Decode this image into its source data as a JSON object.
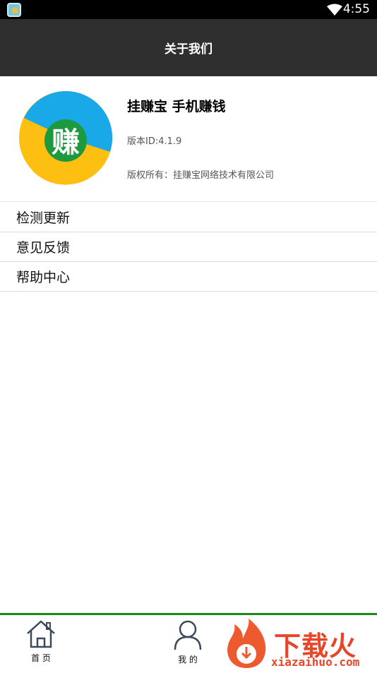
{
  "status_bar": {
    "time": "4:55"
  },
  "header": {
    "title": "关于我们"
  },
  "app": {
    "logo_char": "赚",
    "name": "挂赚宝 手机赚钱",
    "version": "版本ID:4.1.9",
    "copyright": "版权所有：挂赚宝网络技术有限公司"
  },
  "menu": [
    {
      "label": "检测更新"
    },
    {
      "label": "意见反馈"
    },
    {
      "label": "帮助中心"
    }
  ],
  "bottom_nav": [
    {
      "label": "首 页"
    },
    {
      "label": "我 的"
    }
  ],
  "watermark": {
    "text": "下载火",
    "url": "xiazaihuo.com"
  },
  "colors": {
    "title_bar": "#2f2f2f",
    "nav_border": "#1a8a1a",
    "logo_green": "#1e9a3e",
    "logo_blue": "#1aa9e8",
    "logo_yellow": "#fdbf12"
  }
}
